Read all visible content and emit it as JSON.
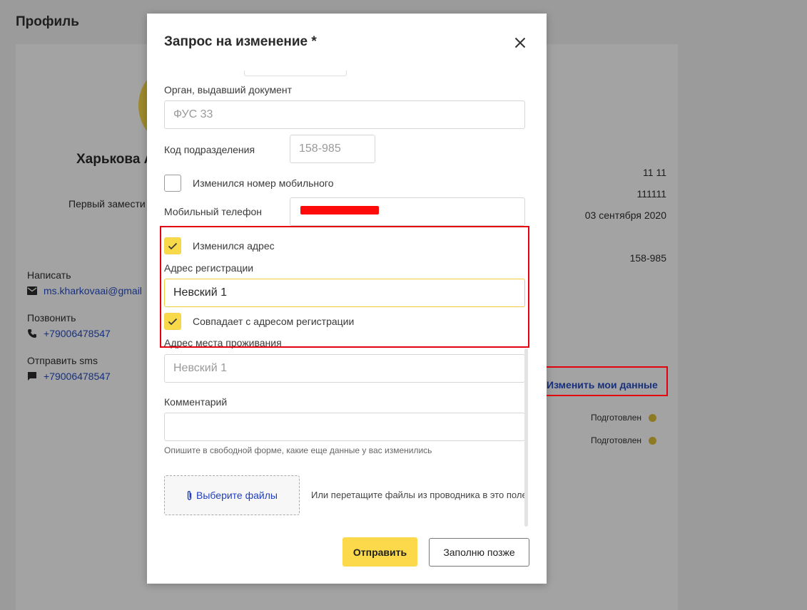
{
  "background": {
    "page_title": "Профиль",
    "name_partial": "Харькова А",
    "position_partial": "Первый замести",
    "contacts": [
      {
        "label": "Написать",
        "value": "ms.kharkovaai@gmail",
        "icon": "mail-icon"
      },
      {
        "label": "Позвонить",
        "value": "+79006478547",
        "icon": "phone-icon"
      },
      {
        "label": "Отправить sms",
        "value": "+79006478547",
        "icon": "chat-icon"
      }
    ],
    "right_values": [
      "11 11",
      "111111",
      "03 сентября 2020",
      "158-985"
    ],
    "edit_link": "Изменить мои данные",
    "statuses": [
      "Подготовлен",
      "Подготовлен"
    ]
  },
  "modal": {
    "title": "Запрос на изменение *",
    "fields": {
      "issuer_label": "Орган, выдавший документ",
      "issuer_value": "ФУС 33",
      "division_code_label": "Код подразделения",
      "division_code_value": "158-985",
      "mobile_changed_label": "Изменился номер мобильного",
      "mobile_changed_checked": false,
      "mobile_label": "Мобильный телефон",
      "address_changed_label": "Изменился адрес",
      "address_changed_checked": true,
      "registration_address_label": "Адрес регистрации",
      "registration_address_value": "Невский 1",
      "same_address_label": "Совпадает с адресом регистрации",
      "same_address_checked": true,
      "residence_address_label": "Адрес места проживания",
      "residence_address_value": "Невский 1",
      "comment_label": "Комментарий",
      "comment_value": "",
      "comment_hint": "Опишите в свободной форме, какие еще данные у вас изменились"
    },
    "upload": {
      "button_label": "Выберите файлы",
      "hint": "Или перетащите файлы из проводника в это поле"
    },
    "actions": {
      "submit_label": "Отправить",
      "later_label": "Заполню позже"
    }
  },
  "colors": {
    "accent_yellow": "#fbd94a",
    "highlight_red": "#e3000f",
    "link_blue": "#1f3fbf"
  }
}
